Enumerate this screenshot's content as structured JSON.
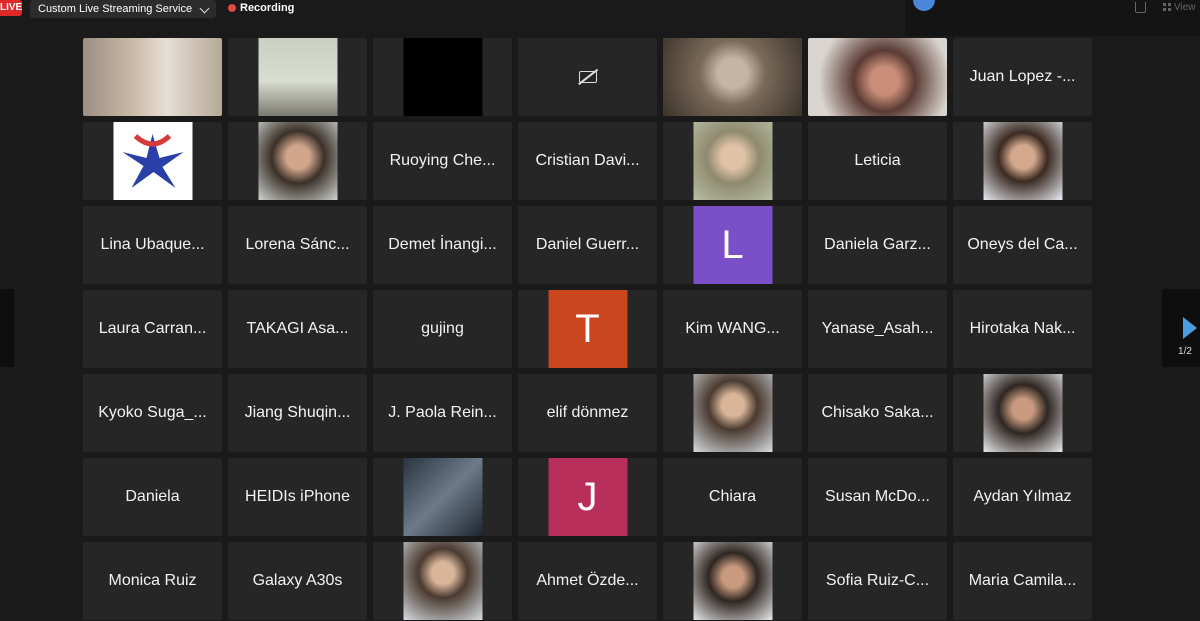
{
  "topbar": {
    "live_label": "LIVE",
    "stream_label": "Custom Live Streaming Service",
    "recording_label": "Recording",
    "view_label": "View"
  },
  "pager": {
    "page_indicator": "1/2"
  },
  "tiles": [
    {
      "type": "photo",
      "name": ""
    },
    {
      "type": "photo",
      "name": ""
    },
    {
      "type": "photo",
      "name": ""
    },
    {
      "type": "camera_off",
      "name": ""
    },
    {
      "type": "photo",
      "name": "",
      "talking": true
    },
    {
      "type": "photo",
      "name": ""
    },
    {
      "type": "name",
      "name": "Juan Lopez -..."
    },
    {
      "type": "photo",
      "name": ""
    },
    {
      "type": "photo",
      "name": ""
    },
    {
      "type": "name",
      "name": "Ruoying Che..."
    },
    {
      "type": "name",
      "name": "Cristian Davi..."
    },
    {
      "type": "photo",
      "name": ""
    },
    {
      "type": "name",
      "name": "Leticia"
    },
    {
      "type": "photo",
      "name": ""
    },
    {
      "type": "name",
      "name": "Lina Ubaque..."
    },
    {
      "type": "name",
      "name": "Lorena Sánc..."
    },
    {
      "type": "name",
      "name": "Demet İnangi..."
    },
    {
      "type": "name",
      "name": "Daniel Guerr..."
    },
    {
      "type": "avatar",
      "letter": "L",
      "color": "#7a4fc7"
    },
    {
      "type": "name",
      "name": "Daniela Garz..."
    },
    {
      "type": "name",
      "name": "Oneys del Ca..."
    },
    {
      "type": "name",
      "name": "Laura Carran..."
    },
    {
      "type": "name",
      "name": "TAKAGI  Asa..."
    },
    {
      "type": "name",
      "name": "gujing"
    },
    {
      "type": "avatar",
      "letter": "T",
      "color": "#c9461f"
    },
    {
      "type": "name",
      "name": "Kim WANG..."
    },
    {
      "type": "name",
      "name": "Yanase_Asah..."
    },
    {
      "type": "name",
      "name": "Hirotaka Nak..."
    },
    {
      "type": "name",
      "name": "Kyoko Suga_..."
    },
    {
      "type": "name",
      "name": "Jiang Shuqin..."
    },
    {
      "type": "name",
      "name": "J. Paola Rein..."
    },
    {
      "type": "name",
      "name": "elif dönmez"
    },
    {
      "type": "photo",
      "name": ""
    },
    {
      "type": "name",
      "name": "Chisako Saka..."
    },
    {
      "type": "photo",
      "name": ""
    },
    {
      "type": "name",
      "name": "Daniela"
    },
    {
      "type": "name",
      "name": "HEIDIs iPhone"
    },
    {
      "type": "photo",
      "name": ""
    },
    {
      "type": "avatar",
      "letter": "J",
      "color": "#b82f5c"
    },
    {
      "type": "name",
      "name": "Chiara"
    },
    {
      "type": "name",
      "name": "Susan McDo..."
    },
    {
      "type": "name",
      "name": "Aydan Yılmaz"
    },
    {
      "type": "name",
      "name": "Monica Ruiz"
    },
    {
      "type": "name",
      "name": "Galaxy A30s"
    },
    {
      "type": "photo",
      "name": ""
    },
    {
      "type": "name",
      "name": "Ahmet Özde..."
    },
    {
      "type": "photo",
      "name": ""
    },
    {
      "type": "name",
      "name": "Sofia Ruiz-C..."
    },
    {
      "type": "name",
      "name": "Maria Camila..."
    }
  ]
}
